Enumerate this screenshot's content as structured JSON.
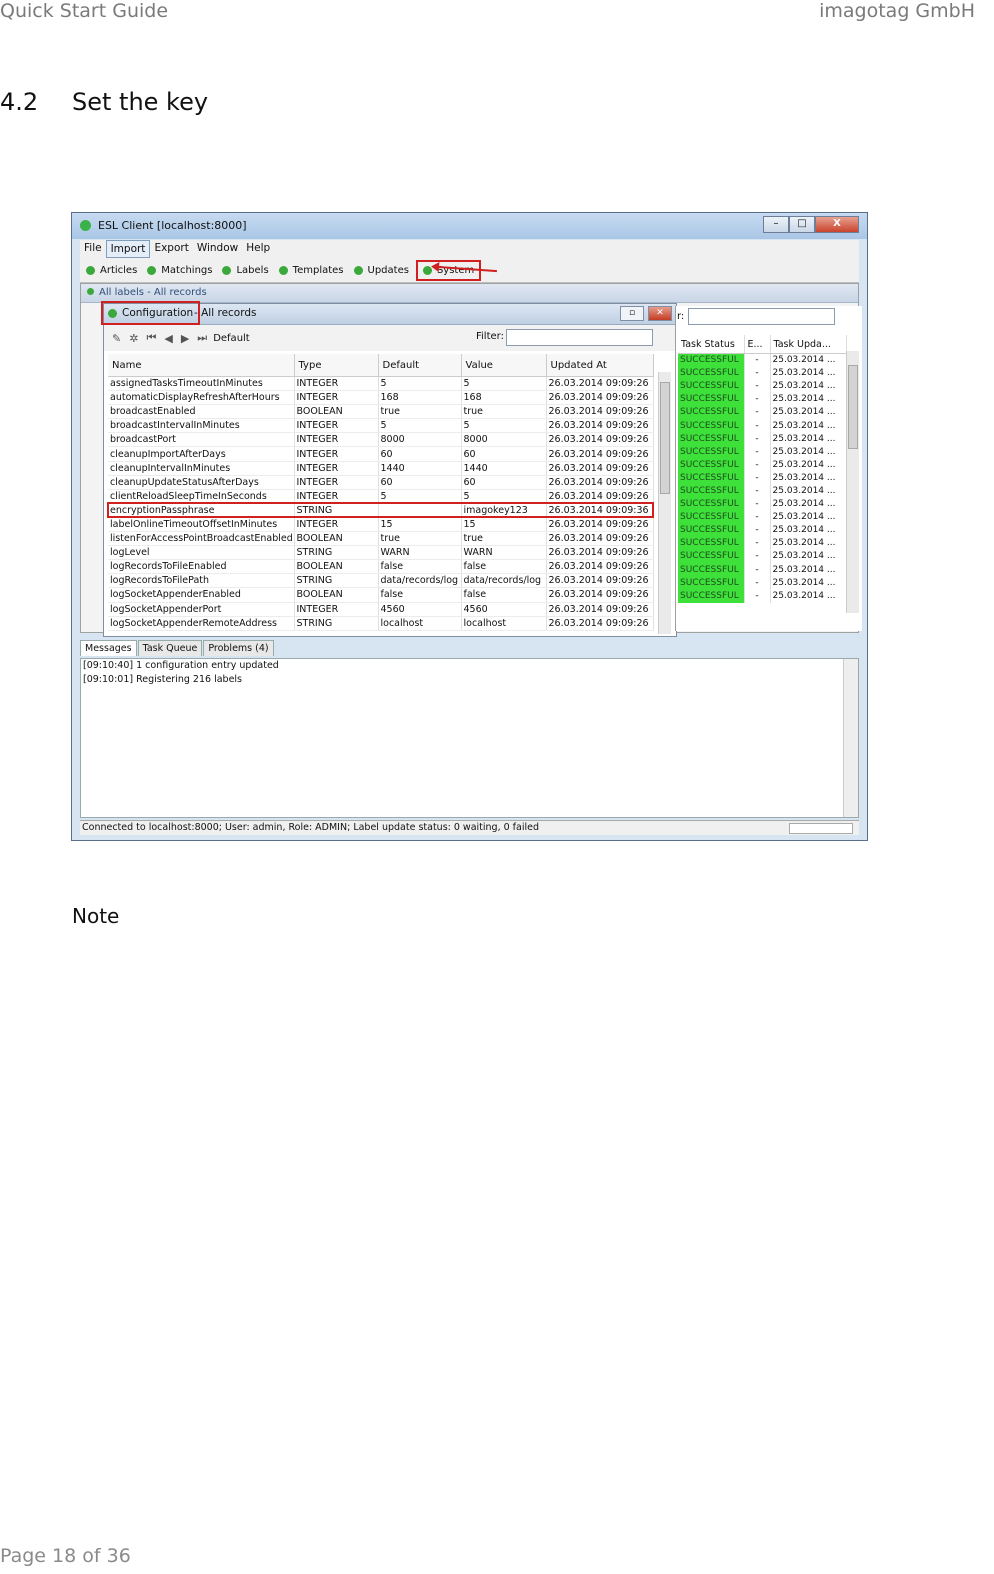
{
  "header": {
    "left": "Quick Start Guide",
    "right": "imagotag GmbH"
  },
  "section": {
    "number": "4.2",
    "title": "Set the key"
  },
  "note_heading": "Note",
  "footer": "Page 18 of 36",
  "screenshot": {
    "window_title": "ESL Client [localhost:8000]",
    "window_buttons": {
      "minimize": "–",
      "restore": "□",
      "close": "X"
    },
    "menu": [
      "File",
      "Import",
      "Export",
      "Window",
      "Help"
    ],
    "toolbar": [
      "Articles",
      "Matchings",
      "Labels",
      "Templates",
      "Updates",
      "System"
    ],
    "background_panel_title": "All labels - All records",
    "config": {
      "title_main": "Configuration",
      "title_rest": "- All records",
      "toolbar_default": "Default",
      "filter_label": "Filter:",
      "columns": [
        "Name",
        "Type",
        "Default",
        "Value",
        "Updated At"
      ],
      "rows": [
        [
          "assignedTasksTimeoutInMinutes",
          "INTEGER",
          "5",
          "5",
          "26.03.2014 09:09:26"
        ],
        [
          "automaticDisplayRefreshAfterHours",
          "INTEGER",
          "168",
          "168",
          "26.03.2014 09:09:26"
        ],
        [
          "broadcastEnabled",
          "BOOLEAN",
          "true",
          "true",
          "26.03.2014 09:09:26"
        ],
        [
          "broadcastIntervalInMinutes",
          "INTEGER",
          "5",
          "5",
          "26.03.2014 09:09:26"
        ],
        [
          "broadcastPort",
          "INTEGER",
          "8000",
          "8000",
          "26.03.2014 09:09:26"
        ],
        [
          "cleanupImportAfterDays",
          "INTEGER",
          "60",
          "60",
          "26.03.2014 09:09:26"
        ],
        [
          "cleanupIntervalInMinutes",
          "INTEGER",
          "1440",
          "1440",
          "26.03.2014 09:09:26"
        ],
        [
          "cleanupUpdateStatusAfterDays",
          "INTEGER",
          "60",
          "60",
          "26.03.2014 09:09:26"
        ],
        [
          "clientReloadSleepTimeInSeconds",
          "INTEGER",
          "5",
          "5",
          "26.03.2014 09:09:26"
        ],
        [
          "encryptionPassphrase",
          "STRING",
          "",
          "imagokey123",
          "26.03.2014 09:09:36"
        ],
        [
          "labelOnlineTimeoutOffsetInMinutes",
          "INTEGER",
          "15",
          "15",
          "26.03.2014 09:09:26"
        ],
        [
          "listenForAccessPointBroadcastEnabled",
          "BOOLEAN",
          "true",
          "true",
          "26.03.2014 09:09:26"
        ],
        [
          "logLevel",
          "STRING",
          "WARN",
          "WARN",
          "26.03.2014 09:09:26"
        ],
        [
          "logRecordsToFileEnabled",
          "BOOLEAN",
          "false",
          "false",
          "26.03.2014 09:09:26"
        ],
        [
          "logRecordsToFilePath",
          "STRING",
          "data/records/log",
          "data/records/log",
          "26.03.2014 09:09:26"
        ],
        [
          "logSocketAppenderEnabled",
          "BOOLEAN",
          "false",
          "false",
          "26.03.2014 09:09:26"
        ],
        [
          "logSocketAppenderPort",
          "INTEGER",
          "4560",
          "4560",
          "26.03.2014 09:09:26"
        ],
        [
          "logSocketAppenderRemoteAddress",
          "STRING",
          "localhost",
          "localhost",
          "26.03.2014 09:09:26"
        ]
      ]
    },
    "right_panel": {
      "filter_label": "r:",
      "columns": [
        "Task Status",
        "E...",
        "Task Upda..."
      ],
      "status": "SUCCESSFUL",
      "dash": "-",
      "date": "25.03.2014 ..."
    },
    "tabs": [
      "Messages",
      "Task Queue",
      "Problems (4)"
    ],
    "messages": [
      "[09:10:40] 1 configuration entry updated",
      "[09:10:01] Registering 216 labels"
    ],
    "status_bar": "Connected to localhost:8000; User: admin, Role: ADMIN; Label update status: 0 waiting, 0 failed"
  }
}
